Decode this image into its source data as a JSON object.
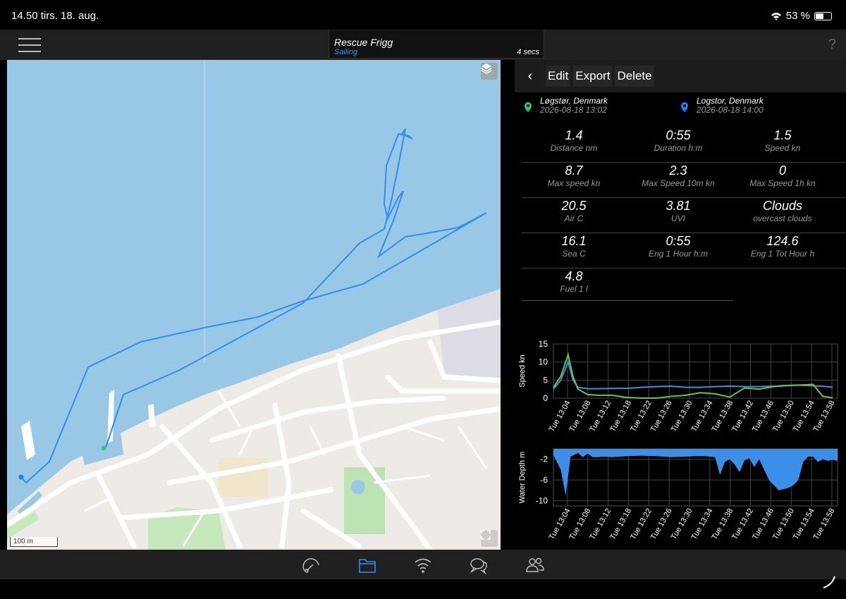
{
  "status": {
    "time": "14.50  tirs. 18. aug.",
    "battery": "53 %"
  },
  "header": {
    "boat_name": "Rescue Frigg",
    "mode": "Sailing",
    "interval": "4 secs",
    "help": "?"
  },
  "map": {
    "scale_label": "100 m"
  },
  "toolbar": {
    "back": "‹",
    "edit": "Edit",
    "export": "Export",
    "delete": "Delete"
  },
  "trip": {
    "start": {
      "place": "Løgstør, Denmark",
      "date": "2026-08-18 13:02"
    },
    "end": {
      "place": "Logstor, Denmark",
      "date": "2026-08-18 14:00"
    }
  },
  "stats": [
    [
      {
        "value": "1.4",
        "label": "Distance nm"
      },
      {
        "value": "0:55",
        "label": "Duration h:m"
      },
      {
        "value": "1.5",
        "label": "Speed kn"
      }
    ],
    [
      {
        "value": "8.7",
        "label": "Max speed kn"
      },
      {
        "value": "2.3",
        "label": "Max Speed 10m kn"
      },
      {
        "value": "0",
        "label": "Max Speed 1h kn"
      }
    ],
    [
      {
        "value": "20.5",
        "label": "Air C"
      },
      {
        "value": "3.81",
        "label": "UVI"
      },
      {
        "value": "Clouds",
        "label": "overcast clouds"
      }
    ],
    [
      {
        "value": "16.1",
        "label": "Sea C"
      },
      {
        "value": "0:55",
        "label": "Eng 1 Hour h:m"
      },
      {
        "value": "124.6",
        "label": "Eng 1 Tot Hour h"
      }
    ],
    [
      {
        "value": "4.8",
        "label": "Fuel 1 l"
      }
    ]
  ],
  "colors": {
    "accent": "#3b8fe8",
    "start_pin": "#2ecc71",
    "end_pin": "#1e7ff0",
    "track": "#2f8ff0"
  },
  "icons": [
    "menu-icon",
    "layers-icon",
    "fullscreen-icon",
    "gauge-icon",
    "folder-icon",
    "wifi-icon",
    "chat-icon",
    "people-icon"
  ],
  "chart_data": [
    {
      "type": "line",
      "ylabel": "Speed kn",
      "ylim": [
        0,
        15
      ],
      "yticks": [
        0,
        5,
        10,
        15
      ],
      "x": [
        "Tue 13:04",
        "Tue 13:08",
        "Tue 13:12",
        "Tue 13:18",
        "Tue 13:22",
        "Tue 13:26",
        "Tue 13:30",
        "Tue 13:34",
        "Tue 13:38",
        "Tue 13:42",
        "Tue 13:46",
        "Tue 13:50",
        "Tue 13:54",
        "Tue 13:58"
      ],
      "x_minutes": [
        0,
        1.5,
        3,
        4,
        5,
        7,
        9,
        12,
        15,
        18,
        21,
        24,
        27,
        30,
        33,
        36,
        39,
        42,
        45,
        47,
        50,
        53,
        55,
        57
      ],
      "series": [
        {
          "values": [
            2.5,
            5,
            10,
            5,
            3,
            2.6,
            2.6,
            2.7,
            2.7,
            3,
            3.2,
            3.3,
            3,
            3,
            3.2,
            3.3,
            3.2,
            3.2,
            3.3,
            3.5,
            3.6,
            3.4,
            3.3,
            3
          ],
          "color": "#3b8fe8"
        },
        {
          "values": [
            3,
            6,
            12,
            6,
            2.5,
            1,
            0.8,
            0.8,
            0.2,
            0,
            0,
            0.5,
            0.8,
            1.5,
            1.2,
            0.3,
            2.8,
            2.5,
            3.2,
            3.4,
            3.6,
            3.8,
            0.5,
            0.1
          ],
          "color": "#6cc24a"
        }
      ]
    },
    {
      "type": "area",
      "ylabel": "Water Depth m",
      "ylim": [
        -11,
        0
      ],
      "yticks": [
        -2,
        -6,
        -10
      ],
      "x": [
        "Tue 13:04",
        "Tue 13:08",
        "Tue 13:12",
        "Tue 13:18",
        "Tue 13:22",
        "Tue 13:26",
        "Tue 13:30",
        "Tue 13:34",
        "Tue 13:38",
        "Tue 13:42",
        "Tue 13:46",
        "Tue 13:50",
        "Tue 13:54",
        "Tue 13:58"
      ],
      "x_minutes": [
        0,
        1.5,
        2.5,
        3.5,
        5,
        6,
        7,
        8,
        9,
        10,
        12,
        15,
        18,
        21,
        24,
        27,
        29,
        31,
        33,
        34,
        35,
        36,
        37,
        38,
        39,
        40,
        41,
        42,
        43,
        44,
        46,
        48,
        49,
        50,
        51,
        52,
        53,
        54,
        55,
        56,
        57,
        58
      ],
      "series": [
        {
          "values": [
            -1.2,
            -4,
            -9,
            -1.5,
            -0.8,
            -1.6,
            -0.9,
            -1.6,
            -1.6,
            -1.5,
            -1.6,
            -1.4,
            -1.3,
            -1.4,
            -1.6,
            -1.5,
            -1.4,
            -1.4,
            -1.6,
            -5,
            -2.5,
            -2,
            -3,
            -4.5,
            -2.2,
            -1.8,
            -3.5,
            -2,
            -4,
            -6,
            -8,
            -7.5,
            -7,
            -6,
            -2.5,
            -1.5,
            -1.5,
            -2.5,
            -2,
            -2.3,
            -2.1,
            -2.3
          ],
          "color": "#3b8fe8"
        }
      ]
    }
  ]
}
